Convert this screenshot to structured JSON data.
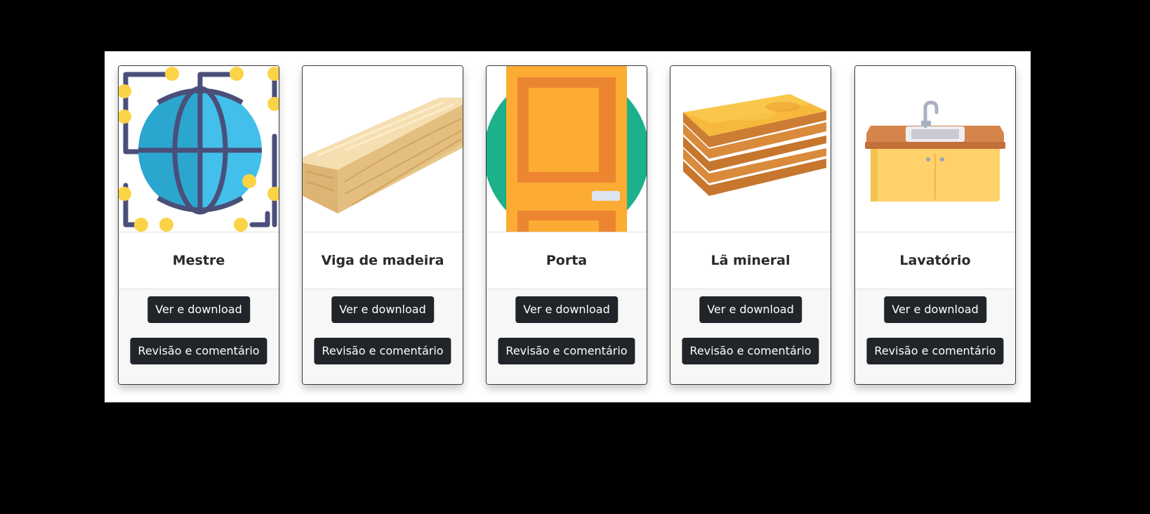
{
  "cards": [
    {
      "title": "Mestre",
      "icon": "globe-network-icon",
      "view_label": "Ver e download",
      "review_label": "Revisão e comentário"
    },
    {
      "title": "Viga de madeira",
      "icon": "wooden-beam-icon",
      "view_label": "Ver e download",
      "review_label": "Revisão e comentário"
    },
    {
      "title": "Porta",
      "icon": "door-icon",
      "view_label": "Ver e download",
      "review_label": "Revisão e comentário"
    },
    {
      "title": "Lã mineral",
      "icon": "mineral-wool-icon",
      "view_label": "Ver e download",
      "review_label": "Revisão e comentário"
    },
    {
      "title": "Lavatório",
      "icon": "sink-cabinet-icon",
      "view_label": "Ver e download",
      "review_label": "Revisão e comentário"
    }
  ],
  "colors": {
    "button_bg": "#212529",
    "button_text": "#ffffff",
    "card_footer_bg": "#f7f7f7",
    "page_bg": "#000000"
  }
}
